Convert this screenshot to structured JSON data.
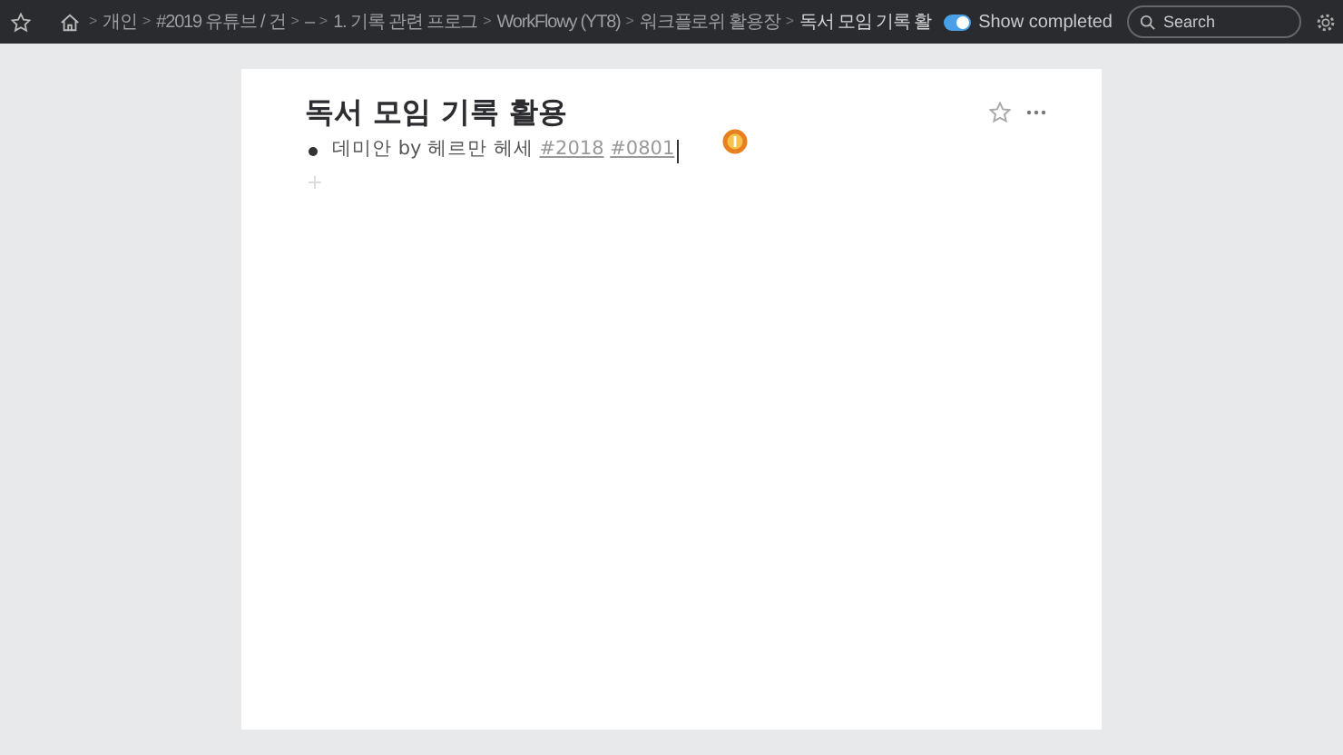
{
  "topbar": {
    "breadcrumbs": [
      "개인",
      "#2019 유튜브 / 건",
      "–",
      "1. 기록 관련 프로그",
      "WorkFlowy (YT8)",
      "워크플로위 활용장",
      "독서 모임 기록 활"
    ],
    "separator": ">",
    "show_completed": {
      "label": "Show completed",
      "on": true
    },
    "search": {
      "placeholder": "Search"
    }
  },
  "document": {
    "title": "독서 모임 기록 활용",
    "bullets": [
      {
        "text": "데미안 by 헤르만 헤세",
        "tags": [
          "#2018",
          "#0801"
        ],
        "editing": true
      }
    ]
  }
}
